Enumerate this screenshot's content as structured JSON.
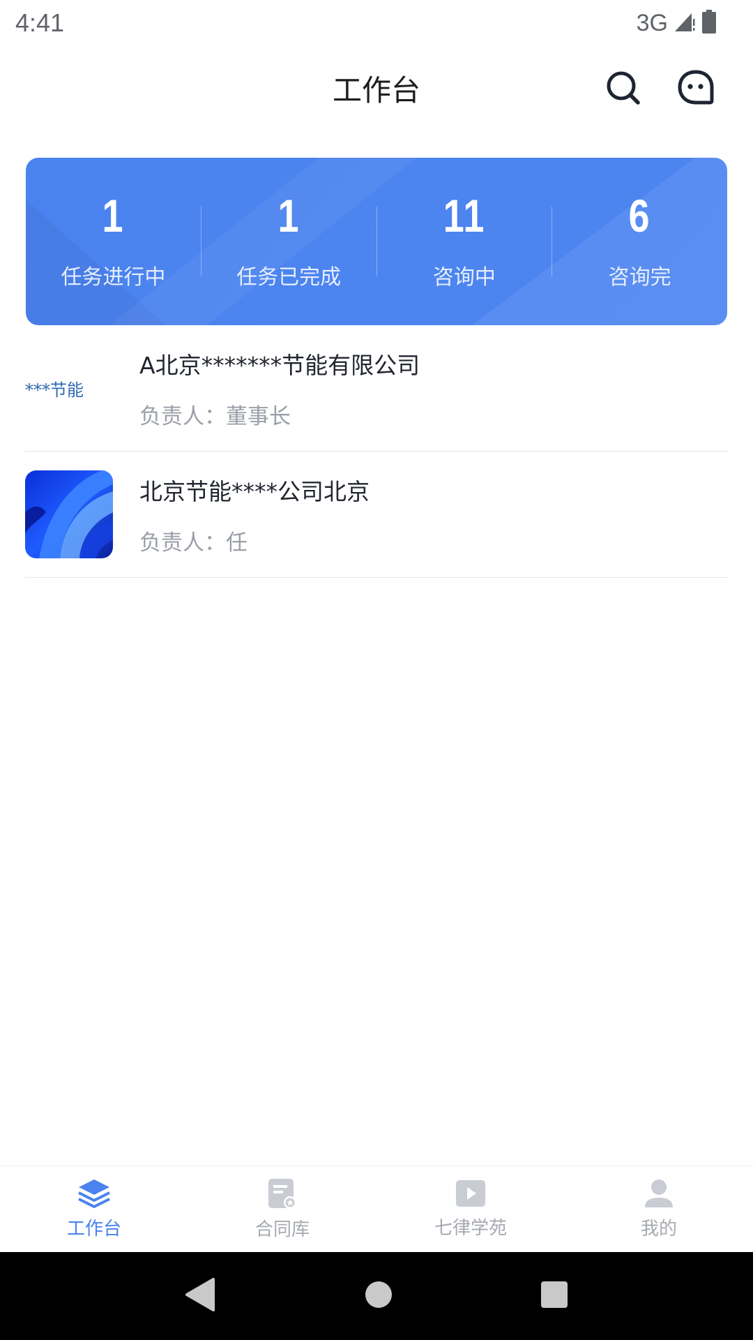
{
  "status_bar": {
    "time": "4:41",
    "network": "3G"
  },
  "header": {
    "title": "工作台"
  },
  "stats": [
    {
      "value": "1",
      "label": "任务进行中"
    },
    {
      "value": "1",
      "label": "任务已完成"
    },
    {
      "value": "11",
      "label": "咨询中"
    },
    {
      "value": "6",
      "label": "咨询完"
    }
  ],
  "companies": [
    {
      "name": "A北京*******节能有限公司",
      "owner": "负责人：董事长",
      "logo_text": "***节能"
    },
    {
      "name": "北京节能****公司北京",
      "owner": "负责人：任"
    }
  ],
  "nav": [
    {
      "label": "工作台",
      "icon": "layers-icon",
      "active": true
    },
    {
      "label": "合同库",
      "icon": "contract-icon",
      "active": false
    },
    {
      "label": "七律学苑",
      "icon": "video-play-icon",
      "active": false
    },
    {
      "label": "我的",
      "icon": "user-icon",
      "active": false
    }
  ],
  "colors": {
    "accent": "#4a82ef",
    "inactive": "#a6a9b0"
  }
}
